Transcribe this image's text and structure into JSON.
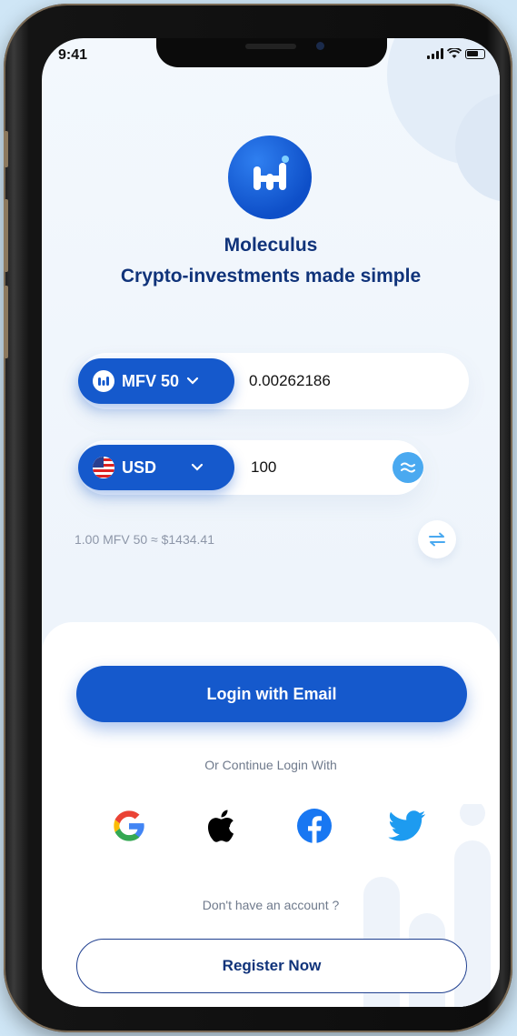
{
  "status_bar": {
    "time": "9:41"
  },
  "brand": {
    "name": "Moleculus",
    "tagline": "Crypto-investments made simple"
  },
  "converter": {
    "crypto": {
      "symbol": "MFV 50",
      "amount": "0.00262186"
    },
    "fiat": {
      "currency": "USD",
      "amount": "100"
    },
    "rate_text": "1.00 MFV 50 ≈ $1434.41"
  },
  "auth": {
    "login_email_label": "Login with Email",
    "or_continue_text": "Or Continue Login With",
    "social_providers": [
      "google-icon",
      "apple-icon",
      "facebook-icon",
      "twitter-icon"
    ],
    "no_account_text": "Don't have an account ?",
    "register_label": "Register Now"
  },
  "colors": {
    "primary": "#1559cc",
    "heading": "#10337a",
    "background": "#cfe6f6",
    "accent_light": "#4aa9f0"
  }
}
